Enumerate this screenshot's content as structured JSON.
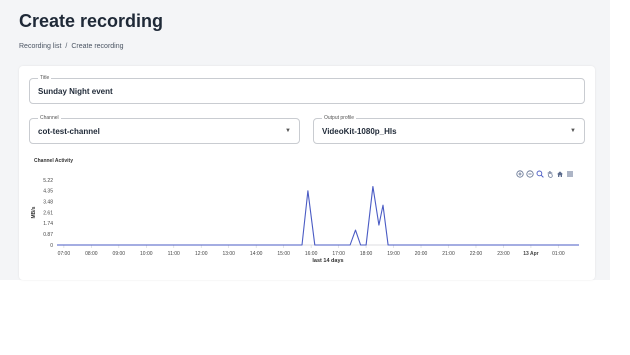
{
  "page": {
    "title": "Create recording",
    "breadcrumb": {
      "parent": "Recording list",
      "separator": "/",
      "current": "Create recording"
    }
  },
  "form": {
    "title": {
      "label": "Title",
      "value": "Sunday Night event"
    },
    "channel": {
      "label": "Channel",
      "value": "cot-test-channel"
    },
    "output_profile": {
      "label": "Output profile",
      "value": "VideoKit-1080p_Hls"
    }
  },
  "toolbar": {
    "icons": [
      "zoom-in-icon",
      "zoom-out-icon",
      "zoom-select-icon",
      "pan-hand-icon",
      "home-icon",
      "menu-icon"
    ]
  },
  "colors": {
    "line": "#4a5bc4",
    "axis": "#d0d3d8"
  },
  "chart_data": {
    "type": "line",
    "title": "Channel Activity",
    "xlabel": "last 14 days",
    "ylabel": "MB/s",
    "ylim": [
      0,
      5.22
    ],
    "yticks": [
      "5.22",
      "4.35",
      "3.48",
      "2.61",
      "1.74",
      "0.87",
      "0"
    ],
    "xticks": [
      {
        "t": 0,
        "label": "07:00"
      },
      {
        "t": 60,
        "label": "08:00"
      },
      {
        "t": 120,
        "label": "09:00"
      },
      {
        "t": 180,
        "label": "10:00"
      },
      {
        "t": 240,
        "label": "11:00"
      },
      {
        "t": 300,
        "label": "12:00"
      },
      {
        "t": 360,
        "label": "13:00"
      },
      {
        "t": 420,
        "label": "14:00"
      },
      {
        "t": 480,
        "label": "15:00"
      },
      {
        "t": 540,
        "label": "16:00"
      },
      {
        "t": 600,
        "label": "17:00"
      },
      {
        "t": 660,
        "label": "18:00"
      },
      {
        "t": 720,
        "label": "19:00"
      },
      {
        "t": 780,
        "label": "20:00"
      },
      {
        "t": 840,
        "label": "21:00"
      },
      {
        "t": 900,
        "label": "22:00"
      },
      {
        "t": 960,
        "label": "23:00"
      },
      {
        "t": 1020,
        "label": "13 Apr",
        "bold": true
      },
      {
        "t": 1080,
        "label": "01:00"
      }
    ],
    "xmin": -15,
    "xmax": 1125,
    "series": [
      {
        "x": [
          -15,
          520,
          533,
          548,
          560,
          625,
          637,
          648,
          660,
          675,
          688,
          697,
          708,
          1125
        ],
        "values": [
          0,
          0,
          4.35,
          0,
          0,
          0,
          1.2,
          0,
          0,
          4.7,
          1.6,
          3.2,
          0,
          0
        ]
      }
    ]
  }
}
